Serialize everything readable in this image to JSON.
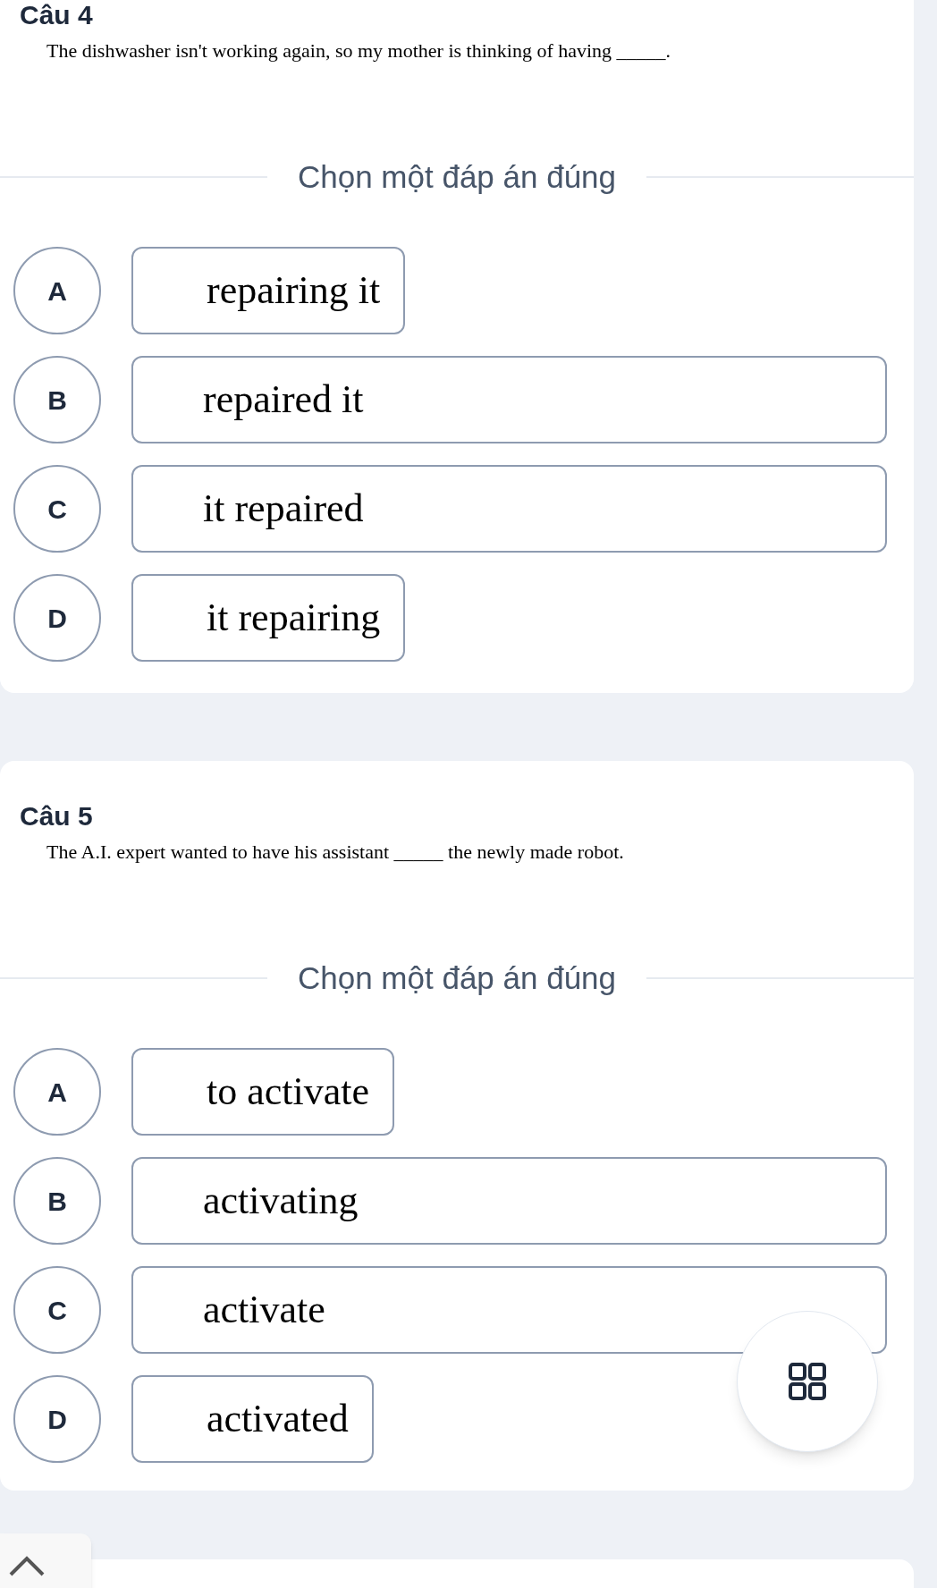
{
  "questions": [
    {
      "title": "Câu 4",
      "text": "The dishwasher isn't working again, so my mother is thinking of having _____.",
      "prompt": "Chọn một đáp án đúng",
      "options": [
        {
          "letter": "A",
          "text": "repairing it",
          "kind": "fit"
        },
        {
          "letter": "B",
          "text": "repaired it",
          "kind": "wide"
        },
        {
          "letter": "C",
          "text": "it repaired",
          "kind": "wide"
        },
        {
          "letter": "D",
          "text": "it repairing",
          "kind": "fit"
        }
      ]
    },
    {
      "title": "Câu 5",
      "text": "The A.I. expert wanted to have his assistant _____ the newly made robot.",
      "prompt": "Chọn một đáp án đúng",
      "options": [
        {
          "letter": "A",
          "text": "to activate",
          "kind": "fit"
        },
        {
          "letter": "B",
          "text": "activating",
          "kind": "wide"
        },
        {
          "letter": "C",
          "text": "activate",
          "kind": "wide"
        },
        {
          "letter": "D",
          "text": "activated",
          "kind": "fit"
        }
      ]
    }
  ]
}
